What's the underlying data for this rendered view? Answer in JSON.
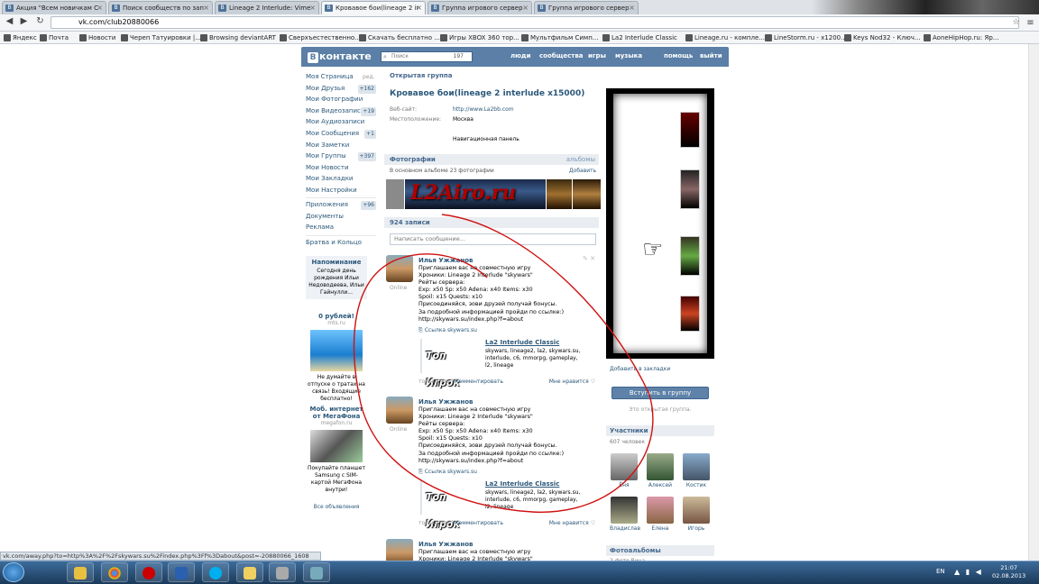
{
  "browser": {
    "tabs": [
      {
        "title": "Акция \"Всем новичкам С",
        "icon": "vk-icon"
      },
      {
        "title": "Поиск сообществ по зап",
        "icon": "vk-icon"
      },
      {
        "title": "Lineage 2 Interlude: Vime",
        "icon": "vk-icon"
      },
      {
        "title": "Кровавое бои(lineage 2 ir",
        "icon": "vk-icon",
        "active": true
      },
      {
        "title": "Группа игрового сервер",
        "icon": "vk-icon"
      },
      {
        "title": "Группа игрового сервер",
        "icon": "vk-icon"
      }
    ],
    "url": "vk.com/club20880066",
    "bookmarks": [
      "Яндекс",
      "Почта",
      "Новости",
      "Череп Татуировки |...",
      "Browsing deviantART",
      "Сверхъестественно...",
      "Скачать бесплатно ...",
      "Игры XBOX 360 тор...",
      "Мультфильм Симп...",
      "La2 Interlude Classic",
      "Lineage.ru - компле...",
      "LineStorm.ru - x1200...",
      "Keys Nod32 - Ключ...",
      "AoneHipHop.ru: Яр..."
    ]
  },
  "vk": {
    "logo": "контакте",
    "search_placeholder": "Поиск",
    "search_count": "197",
    "top_links": [
      "люди",
      "сообщества",
      "игры",
      "музыка",
      "помощь",
      "выйти"
    ],
    "edit_label": "ред.",
    "left_nav": [
      {
        "label": "Моя Страница",
        "count": ""
      },
      {
        "label": "Мои Друзья",
        "count": "+162"
      },
      {
        "label": "Мои Фотографии",
        "count": ""
      },
      {
        "label": "Мои Видеозаписи",
        "count": "+19"
      },
      {
        "label": "Мои Аудиозаписи",
        "count": ""
      },
      {
        "label": "Мои Сообщения",
        "count": "+1"
      },
      {
        "label": "Мои Заметки",
        "count": ""
      },
      {
        "label": "Мои Группы",
        "count": "+397"
      },
      {
        "label": "Мои Новости",
        "count": ""
      },
      {
        "label": "Мои Закладки",
        "count": ""
      },
      {
        "label": "Мои Настройки",
        "count": ""
      }
    ],
    "left_nav2": [
      {
        "label": "Приложения",
        "count": "+96"
      },
      {
        "label": "Документы",
        "count": ""
      },
      {
        "label": "Реклама",
        "count": ""
      }
    ],
    "left_nav3": "Братва и Кольцо",
    "reminder": {
      "title": "Напоминание",
      "text": "Сегодня день рождения Ильи Недоводеева, Ильи Гайнулли..."
    },
    "ads": [
      {
        "title": "0 рублей!",
        "domain": "mts.ru",
        "text": "Не думайте в отпуске о тратах на связь! Входящие бесплатно!"
      },
      {
        "title": "Моб. интернет от МегаФона",
        "domain": "megafon.ru",
        "text": "Покупайте планшет Samsung с SIM-картой МегаФона внутри!"
      }
    ],
    "all_ads": "Все объявления"
  },
  "group": {
    "type": "Открытая группа",
    "title": "Кровавое бои(lineage 2 interlude x15000)",
    "website_label": "Веб-сайт:",
    "website": "http://www.La2bb.com",
    "location_label": "Местоположение:",
    "location": "Москва",
    "nav_panel": "Навигационная панель",
    "photos_header": "Фотографии",
    "albums_link": "альбомы",
    "photos_info": "В основном альбоме 23 фотографии",
    "add_label": "Добавить",
    "banner_text": "L2Airo.ru",
    "posts_count": "924 записи",
    "write_placeholder": "Написать сообщение...",
    "posts": [
      {
        "author": "Илья Ужжанов",
        "status": "Online",
        "text": "Приглашаем вас на совместную игру\nХроники: Lineage 2 Interlude \"skywars\"\nРейты сервера:\nExp: x50 Sp: x50 Adena: x40 Items: x30\nSpoil: x15 Quests: x10\nПрисоединяйся, зови друзей получай бонусы.\nЗа подробной информацией пройди по ссылке:)\nhttp://skywars.su/index.php?f=about",
        "link_label": "Ссылка skywars.su",
        "link_title": "La2 Interlude Classic",
        "link_desc": "skywars, lineage2, la2, skywars.su, interlude, c6, mmorpg, gameplay, l2, lineage",
        "logo_text": "Топ Игрок",
        "time": "только что",
        "comment": "Комментировать",
        "like": "Мне нравится"
      },
      {
        "author": "Илья Ужжанов",
        "status": "Online",
        "text": "Приглашаем вас на совместную игру\nХроники: Lineage 2 Interlude \"skywars\"\nРейты сервера:\nExp: x50 Sp: x50 Adena: x40 Items: x30\nSpoil: x15 Quests: x10\nПрисоединяйся, зови друзей получай бонусы.\nЗа подробной информацией пройди по ссылке:)\nhttp://skywars.su/index.php?f=about",
        "link_label": "Ссылка skywars.su",
        "link_title": "La2 Interlude Classic",
        "link_desc": "skywars, lineage2, la2, skywars.su, interlude, c6, mmorpg, gameplay, l2, lineage",
        "logo_text": "Топ Игрок",
        "time": "только что",
        "comment": "Комментировать",
        "like": "Мне нравится"
      },
      {
        "author": "Илья Ужжанов",
        "text": "Приглашаем вас на совместную игру\nХроники: Lineage 2 Interlude \"skywars\""
      }
    ],
    "bookmark_label": "Добавить в закладки",
    "join_button": "Вступить в группу",
    "open_group_note": "Это открытая группа.",
    "members_header": "Участники",
    "members_count": "607 человек",
    "members": [
      "Ёня",
      "Алексей",
      "Костик",
      "Владислав",
      "Елена",
      "Игорь"
    ],
    "albums_header": "Фотоальбомы",
    "albums_sub": "2 фото Вина"
  },
  "status_url": "vk.com/away.php?to=http%3A%2F%2Fskywars.su%2Findex.php%3Ff%3Dabout&post=-20880066_1608",
  "taskbar": {
    "lang": "EN",
    "time": "21:07",
    "date": "02.08.2013"
  }
}
